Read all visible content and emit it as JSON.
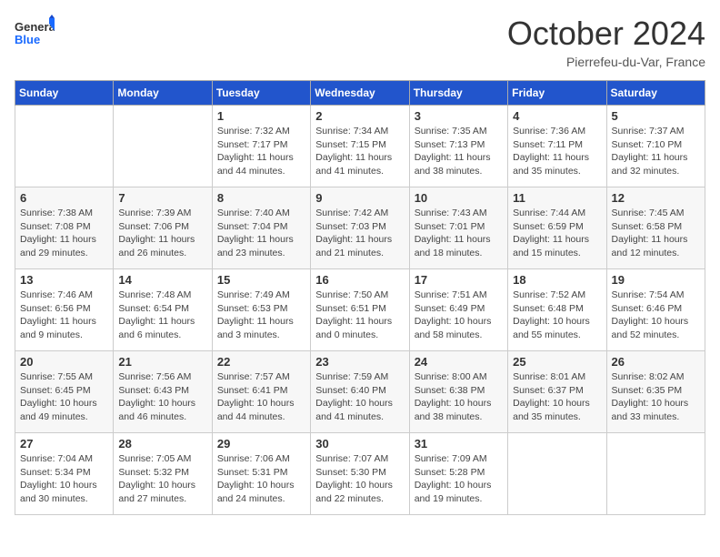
{
  "header": {
    "logo_general": "General",
    "logo_blue": "Blue",
    "month_title": "October 2024",
    "location": "Pierrefeu-du-Var, France"
  },
  "weekdays": [
    "Sunday",
    "Monday",
    "Tuesday",
    "Wednesday",
    "Thursday",
    "Friday",
    "Saturday"
  ],
  "weeks": [
    [
      {
        "day": "",
        "info": ""
      },
      {
        "day": "",
        "info": ""
      },
      {
        "day": "1",
        "info": "Sunrise: 7:32 AM\nSunset: 7:17 PM\nDaylight: 11 hours and 44 minutes."
      },
      {
        "day": "2",
        "info": "Sunrise: 7:34 AM\nSunset: 7:15 PM\nDaylight: 11 hours and 41 minutes."
      },
      {
        "day": "3",
        "info": "Sunrise: 7:35 AM\nSunset: 7:13 PM\nDaylight: 11 hours and 38 minutes."
      },
      {
        "day": "4",
        "info": "Sunrise: 7:36 AM\nSunset: 7:11 PM\nDaylight: 11 hours and 35 minutes."
      },
      {
        "day": "5",
        "info": "Sunrise: 7:37 AM\nSunset: 7:10 PM\nDaylight: 11 hours and 32 minutes."
      }
    ],
    [
      {
        "day": "6",
        "info": "Sunrise: 7:38 AM\nSunset: 7:08 PM\nDaylight: 11 hours and 29 minutes."
      },
      {
        "day": "7",
        "info": "Sunrise: 7:39 AM\nSunset: 7:06 PM\nDaylight: 11 hours and 26 minutes."
      },
      {
        "day": "8",
        "info": "Sunrise: 7:40 AM\nSunset: 7:04 PM\nDaylight: 11 hours and 23 minutes."
      },
      {
        "day": "9",
        "info": "Sunrise: 7:42 AM\nSunset: 7:03 PM\nDaylight: 11 hours and 21 minutes."
      },
      {
        "day": "10",
        "info": "Sunrise: 7:43 AM\nSunset: 7:01 PM\nDaylight: 11 hours and 18 minutes."
      },
      {
        "day": "11",
        "info": "Sunrise: 7:44 AM\nSunset: 6:59 PM\nDaylight: 11 hours and 15 minutes."
      },
      {
        "day": "12",
        "info": "Sunrise: 7:45 AM\nSunset: 6:58 PM\nDaylight: 11 hours and 12 minutes."
      }
    ],
    [
      {
        "day": "13",
        "info": "Sunrise: 7:46 AM\nSunset: 6:56 PM\nDaylight: 11 hours and 9 minutes."
      },
      {
        "day": "14",
        "info": "Sunrise: 7:48 AM\nSunset: 6:54 PM\nDaylight: 11 hours and 6 minutes."
      },
      {
        "day": "15",
        "info": "Sunrise: 7:49 AM\nSunset: 6:53 PM\nDaylight: 11 hours and 3 minutes."
      },
      {
        "day": "16",
        "info": "Sunrise: 7:50 AM\nSunset: 6:51 PM\nDaylight: 11 hours and 0 minutes."
      },
      {
        "day": "17",
        "info": "Sunrise: 7:51 AM\nSunset: 6:49 PM\nDaylight: 10 hours and 58 minutes."
      },
      {
        "day": "18",
        "info": "Sunrise: 7:52 AM\nSunset: 6:48 PM\nDaylight: 10 hours and 55 minutes."
      },
      {
        "day": "19",
        "info": "Sunrise: 7:54 AM\nSunset: 6:46 PM\nDaylight: 10 hours and 52 minutes."
      }
    ],
    [
      {
        "day": "20",
        "info": "Sunrise: 7:55 AM\nSunset: 6:45 PM\nDaylight: 10 hours and 49 minutes."
      },
      {
        "day": "21",
        "info": "Sunrise: 7:56 AM\nSunset: 6:43 PM\nDaylight: 10 hours and 46 minutes."
      },
      {
        "day": "22",
        "info": "Sunrise: 7:57 AM\nSunset: 6:41 PM\nDaylight: 10 hours and 44 minutes."
      },
      {
        "day": "23",
        "info": "Sunrise: 7:59 AM\nSunset: 6:40 PM\nDaylight: 10 hours and 41 minutes."
      },
      {
        "day": "24",
        "info": "Sunrise: 8:00 AM\nSunset: 6:38 PM\nDaylight: 10 hours and 38 minutes."
      },
      {
        "day": "25",
        "info": "Sunrise: 8:01 AM\nSunset: 6:37 PM\nDaylight: 10 hours and 35 minutes."
      },
      {
        "day": "26",
        "info": "Sunrise: 8:02 AM\nSunset: 6:35 PM\nDaylight: 10 hours and 33 minutes."
      }
    ],
    [
      {
        "day": "27",
        "info": "Sunrise: 7:04 AM\nSunset: 5:34 PM\nDaylight: 10 hours and 30 minutes."
      },
      {
        "day": "28",
        "info": "Sunrise: 7:05 AM\nSunset: 5:32 PM\nDaylight: 10 hours and 27 minutes."
      },
      {
        "day": "29",
        "info": "Sunrise: 7:06 AM\nSunset: 5:31 PM\nDaylight: 10 hours and 24 minutes."
      },
      {
        "day": "30",
        "info": "Sunrise: 7:07 AM\nSunset: 5:30 PM\nDaylight: 10 hours and 22 minutes."
      },
      {
        "day": "31",
        "info": "Sunrise: 7:09 AM\nSunset: 5:28 PM\nDaylight: 10 hours and 19 minutes."
      },
      {
        "day": "",
        "info": ""
      },
      {
        "day": "",
        "info": ""
      }
    ]
  ]
}
